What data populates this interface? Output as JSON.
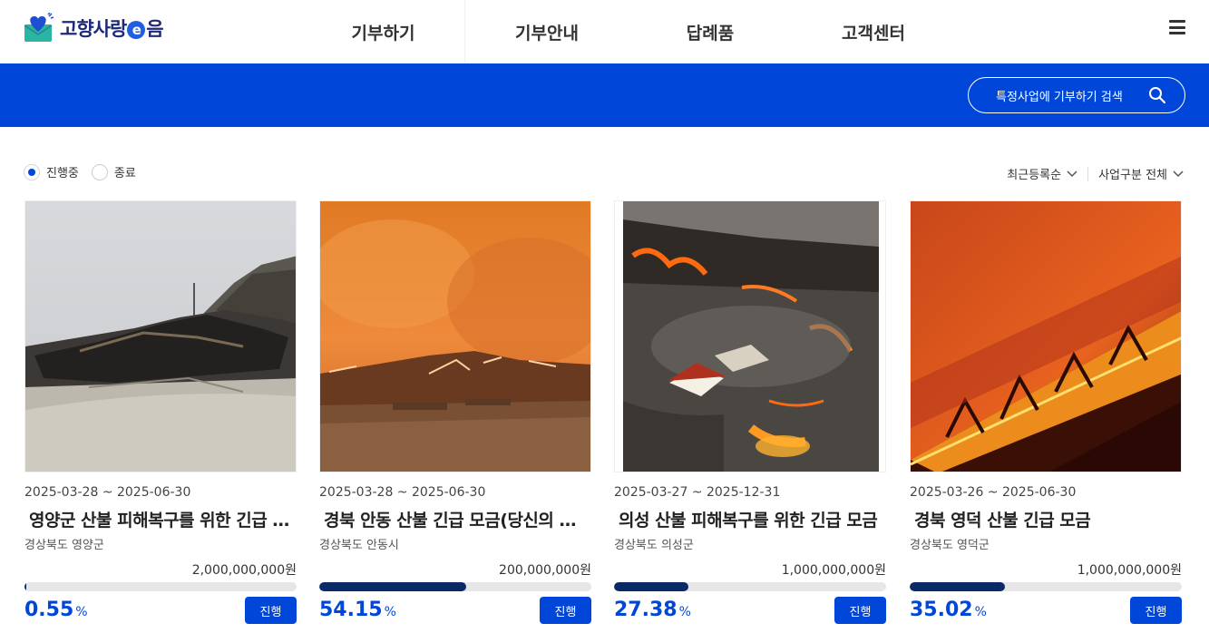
{
  "header": {
    "logo_text_a": "고향사랑",
    "logo_e": "e",
    "logo_text_b": "음",
    "nav": [
      "기부하기",
      "기부안내",
      "답례품",
      "고객센터"
    ],
    "menu_icon": "hamburger-icon"
  },
  "band": {
    "search_label": "특정사업에 기부하기 검색",
    "search_icon": "search-icon",
    "color": "#0047d9"
  },
  "filters": {
    "status_options": [
      {
        "label": "진행중",
        "selected": true
      },
      {
        "label": "종료",
        "selected": false
      }
    ],
    "sort": "최근등록순",
    "category": "사업구분 전체"
  },
  "cards": [
    {
      "date": "2025-03-28 ~ 2025-06-30",
      "title": "영양군 산불 피해복구를 위한 긴급 모금",
      "region": "경상북도 영양군",
      "goal": "2,000,000,000원",
      "percent": "0.55",
      "percent_unit": "%",
      "progress": 0.0055,
      "status": "진행"
    },
    {
      "date": "2025-03-28 ~ 2025-06-30",
      "title": "경북 안동 산불 긴급 모금(당신의 작은 손길)",
      "region": "경상북도 안동시",
      "goal": "200,000,000원",
      "percent": "54.15",
      "percent_unit": "%",
      "progress": 0.5415,
      "status": "진행"
    },
    {
      "date": "2025-03-27 ~ 2025-12-31",
      "title": "의성 산불 피해복구를 위한 긴급 모금",
      "region": "경상북도 의성군",
      "goal": "1,000,000,000원",
      "percent": "27.38",
      "percent_unit": "%",
      "progress": 0.2738,
      "status": "진행"
    },
    {
      "date": "2025-03-26 ~ 2025-06-30",
      "title": "경북 영덕 산불 긴급 모금",
      "region": "경상북도 영덕군",
      "goal": "1,000,000,000원",
      "percent": "35.02",
      "percent_unit": "%",
      "progress": 0.3502,
      "status": "진행"
    }
  ]
}
